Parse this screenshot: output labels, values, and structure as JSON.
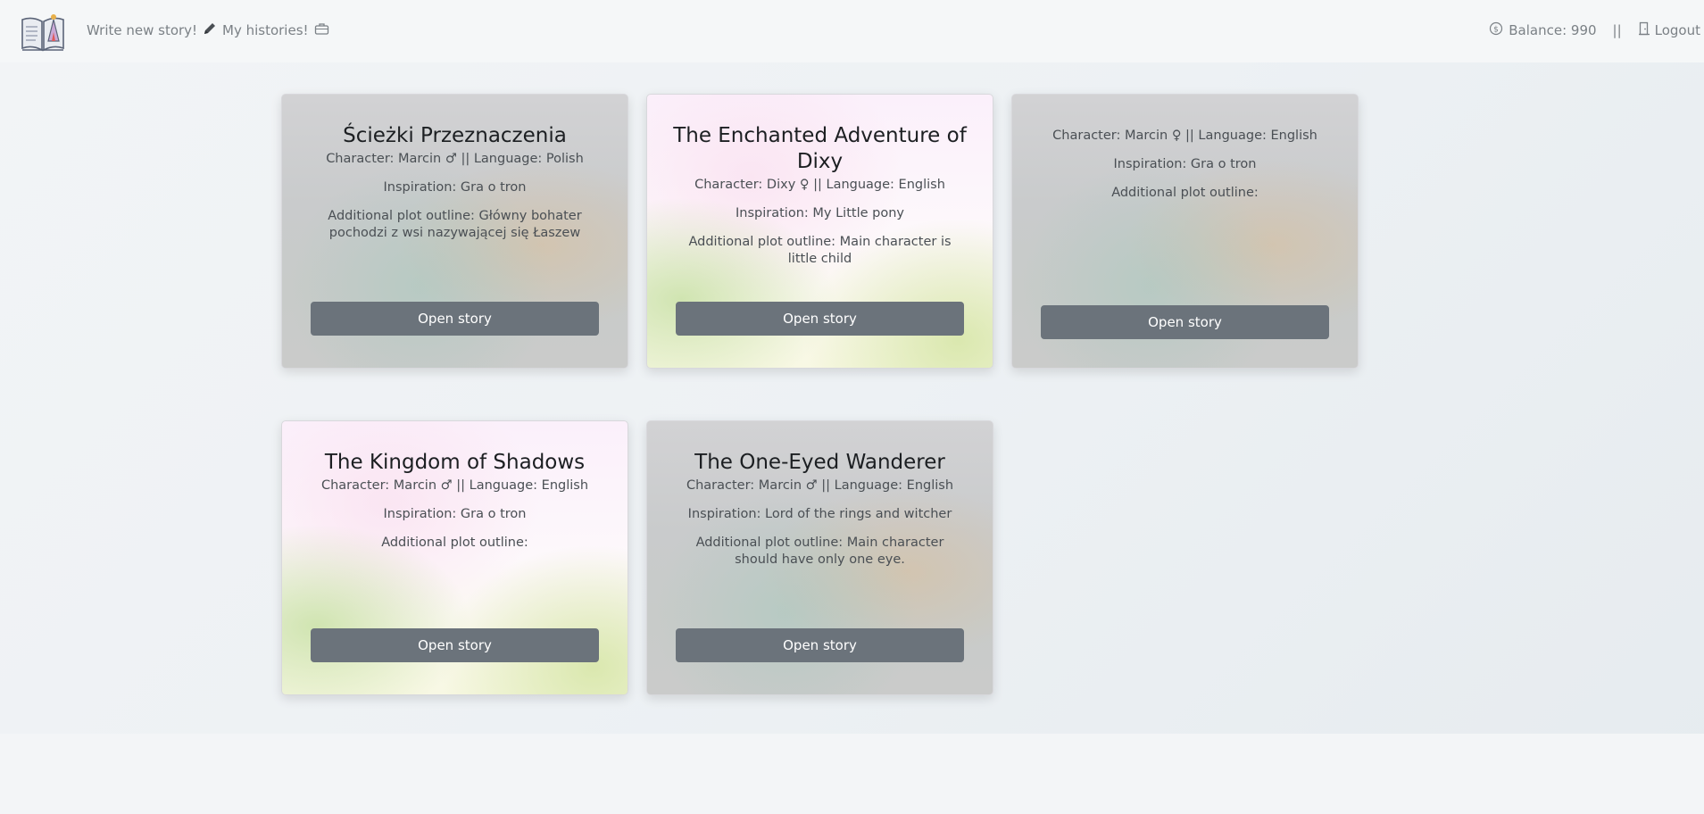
{
  "nav": {
    "write_label": "Write new story!",
    "histories_label": "My histories!",
    "balance_label": "Balance: 990",
    "separator": "||",
    "logout_label": "Logout"
  },
  "stories": [
    {
      "title": "Ścieżki Przeznaczenia",
      "character": "Character: Marcin ♂ || Language: Polish",
      "inspiration": "Inspiration: Gra o tron",
      "outline": "Additional plot outline: Główny bohater pochodzi z wsi nazywającej się Łaszew",
      "button": "Open story"
    },
    {
      "title": "The Enchanted Adventure of Dixy",
      "character": "Character: Dixy ♀ || Language: English",
      "inspiration": "Inspiration: My Little pony",
      "outline": "Additional plot outline: Main character is little child",
      "button": "Open story"
    },
    {
      "title": "",
      "character": "Character: Marcin ♀ || Language: English",
      "inspiration": "Inspiration: Gra o tron",
      "outline": "Additional plot outline:",
      "button": "Open story"
    },
    {
      "title": "The Kingdom of Shadows",
      "character": "Character: Marcin ♂ || Language: English",
      "inspiration": "Inspiration: Gra o tron",
      "outline": "Additional plot outline:",
      "button": "Open story"
    },
    {
      "title": "The One-Eyed Wanderer",
      "character": "Character: Marcin ♂ || Language: English",
      "inspiration": "Inspiration: Lord of the rings and witcher",
      "outline": "Additional plot outline: Main character should have only one eye.",
      "button": "Open story"
    }
  ]
}
